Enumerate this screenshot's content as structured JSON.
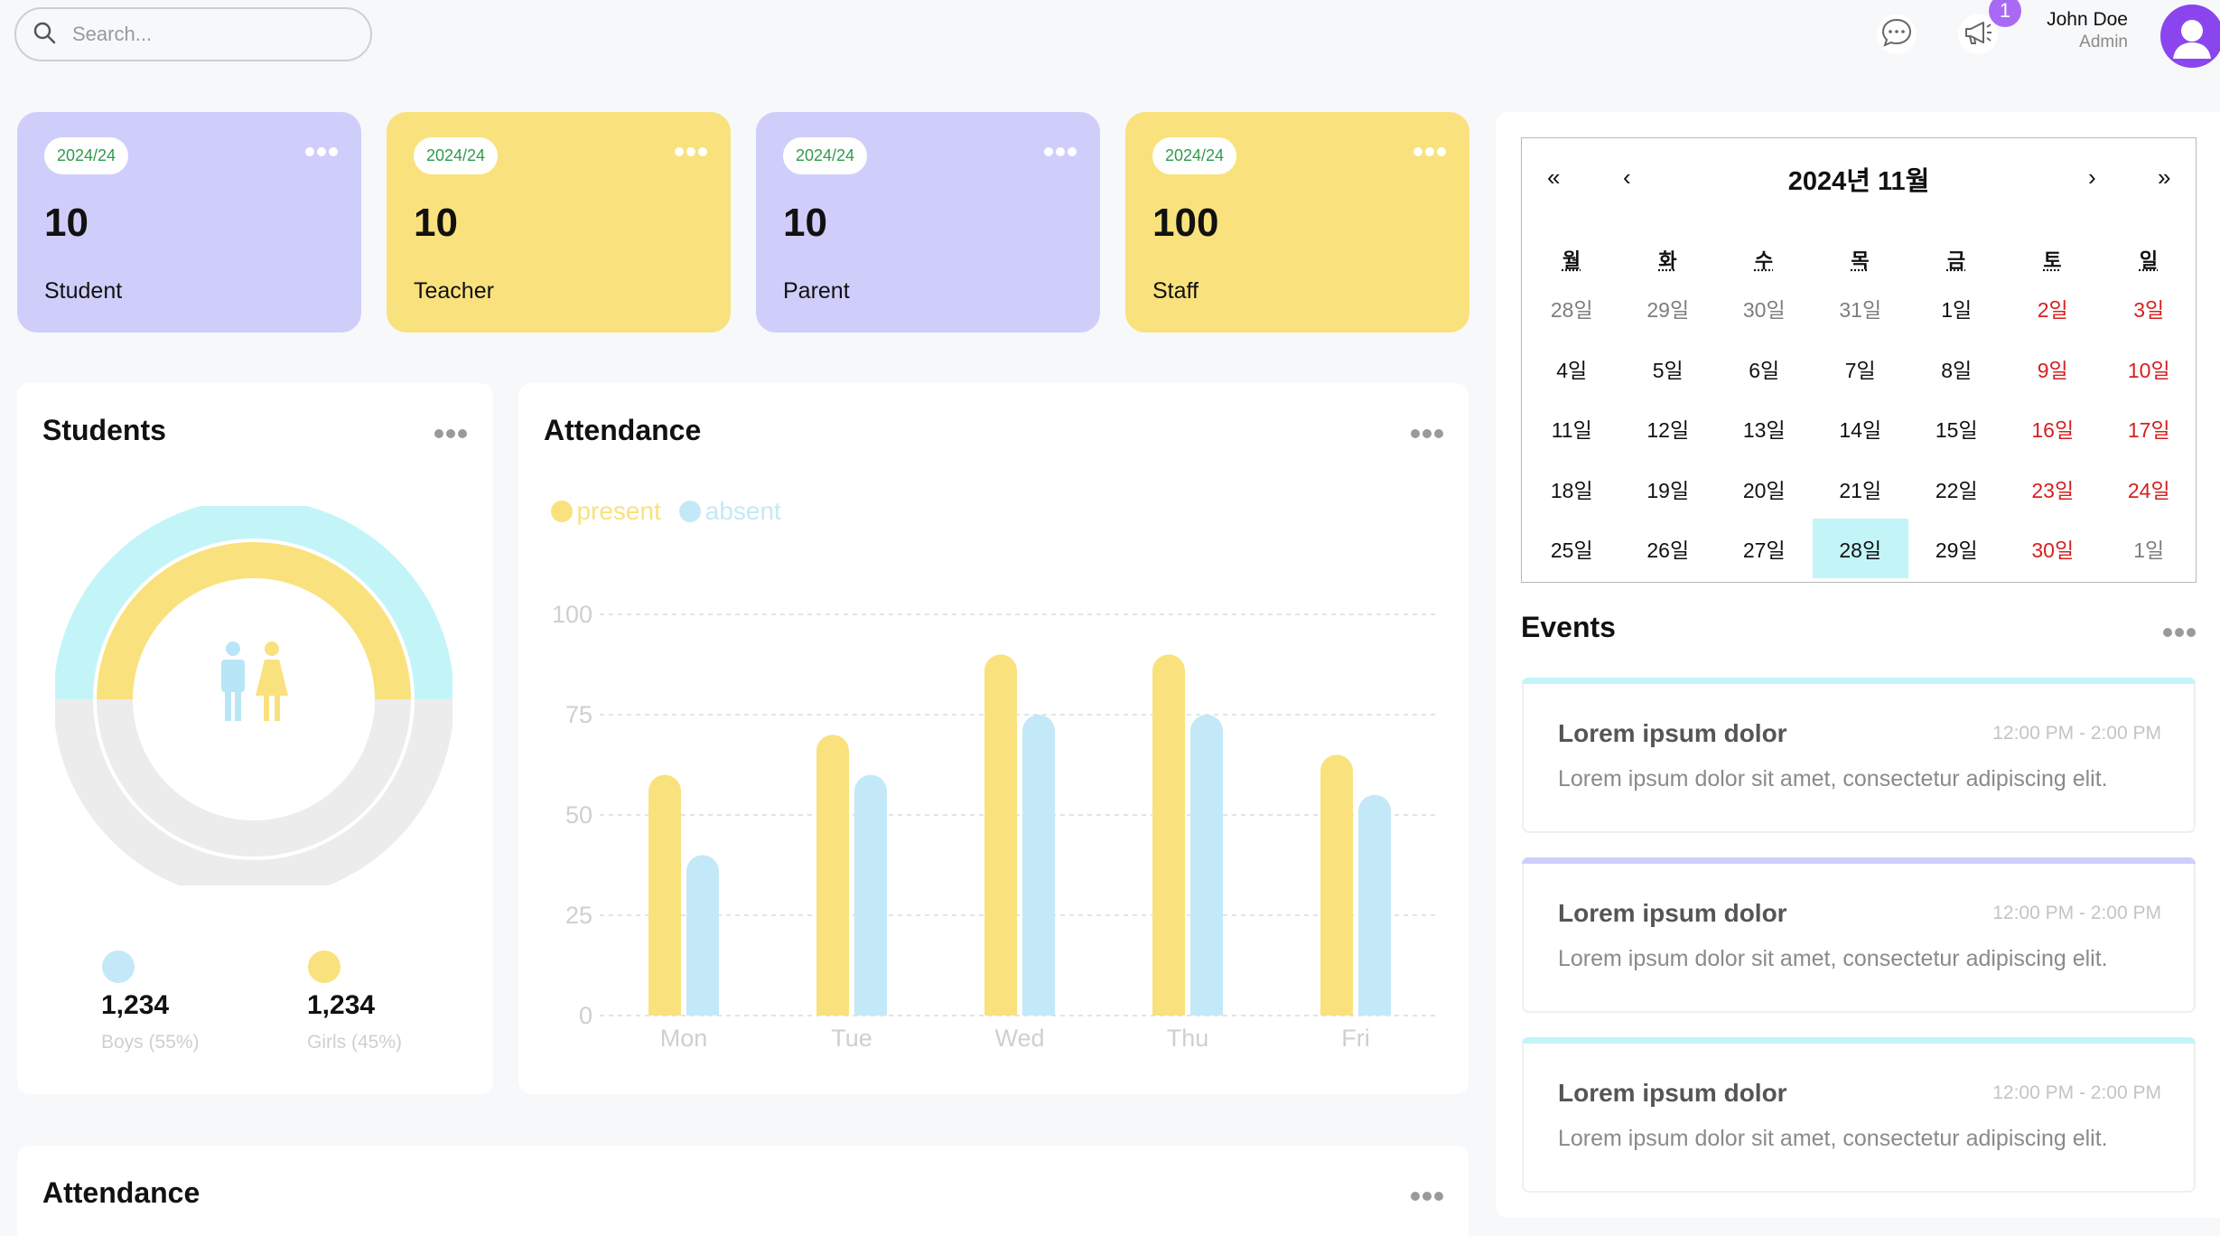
{
  "search": {
    "placeholder": "Search..."
  },
  "user": {
    "name": "John Doe",
    "role": "Admin"
  },
  "notifications": {
    "count": "1"
  },
  "stat_cards": [
    {
      "year": "2024/24",
      "count": "10",
      "label": "Student",
      "color": "#cfcefb"
    },
    {
      "year": "2024/24",
      "count": "10",
      "label": "Teacher",
      "color": "#f9e27d"
    },
    {
      "year": "2024/24",
      "count": "10",
      "label": "Parent",
      "color": "#cfcefb"
    },
    {
      "year": "2024/24",
      "count": "100",
      "label": "Staff",
      "color": "#f9e27d"
    }
  ],
  "students": {
    "title": "Students",
    "boys": {
      "count": "1,234",
      "label": "Boys (55%)",
      "color": "#c3f5f8"
    },
    "girls": {
      "count": "1,234",
      "label": "Girls (45%)",
      "color": "#f9e27d"
    }
  },
  "attendance": {
    "title": "Attendance",
    "legend": {
      "present": "present",
      "absent": "absent"
    }
  },
  "attendance_bottom": {
    "title": "Attendance"
  },
  "chart_data": {
    "type": "bar",
    "categories": [
      "Mon",
      "Tue",
      "Wed",
      "Thu",
      "Fri"
    ],
    "series": [
      {
        "name": "present",
        "values": [
          60,
          70,
          90,
          90,
          65
        ],
        "color": "#f9e27d"
      },
      {
        "name": "absent",
        "values": [
          40,
          60,
          75,
          75,
          55
        ],
        "color": "#c3e9f8"
      }
    ],
    "yticks": [
      "0",
      "25",
      "50",
      "75",
      "100"
    ],
    "ylim": [
      0,
      100
    ],
    "grid": true,
    "legend": "top-left"
  },
  "calendar": {
    "title": "2024년 11월",
    "nav": {
      "first": "«",
      "prev": "‹",
      "next": "›",
      "last": "»"
    },
    "weekdays": [
      "월",
      "화",
      "수",
      "목",
      "금",
      "토",
      "일"
    ],
    "weeks": [
      [
        "28일",
        "29일",
        "30일",
        "31일",
        "1일",
        "2일",
        "3일"
      ],
      [
        "4일",
        "5일",
        "6일",
        "7일",
        "8일",
        "9일",
        "10일"
      ],
      [
        "11일",
        "12일",
        "13일",
        "14일",
        "15일",
        "16일",
        "17일"
      ],
      [
        "18일",
        "19일",
        "20일",
        "21일",
        "22일",
        "23일",
        "24일"
      ],
      [
        "25일",
        "26일",
        "27일",
        "28일",
        "29일",
        "30일",
        "1일"
      ]
    ],
    "today": "28일"
  },
  "events": {
    "title": "Events",
    "items": [
      {
        "title": "Lorem ipsum dolor",
        "time": "12:00 PM - 2:00 PM",
        "description": "Lorem ipsum dolor sit amet, consectetur adipiscing elit.",
        "color": "#c3f5f8"
      },
      {
        "title": "Lorem ipsum dolor",
        "time": "12:00 PM - 2:00 PM",
        "description": "Lorem ipsum dolor sit amet, consectetur adipiscing elit.",
        "color": "#cfcefb"
      },
      {
        "title": "Lorem ipsum dolor",
        "time": "12:00 PM - 2:00 PM",
        "description": "Lorem ipsum dolor sit amet, consectetur adipiscing elit.",
        "color": "#c3f5f8"
      }
    ]
  }
}
